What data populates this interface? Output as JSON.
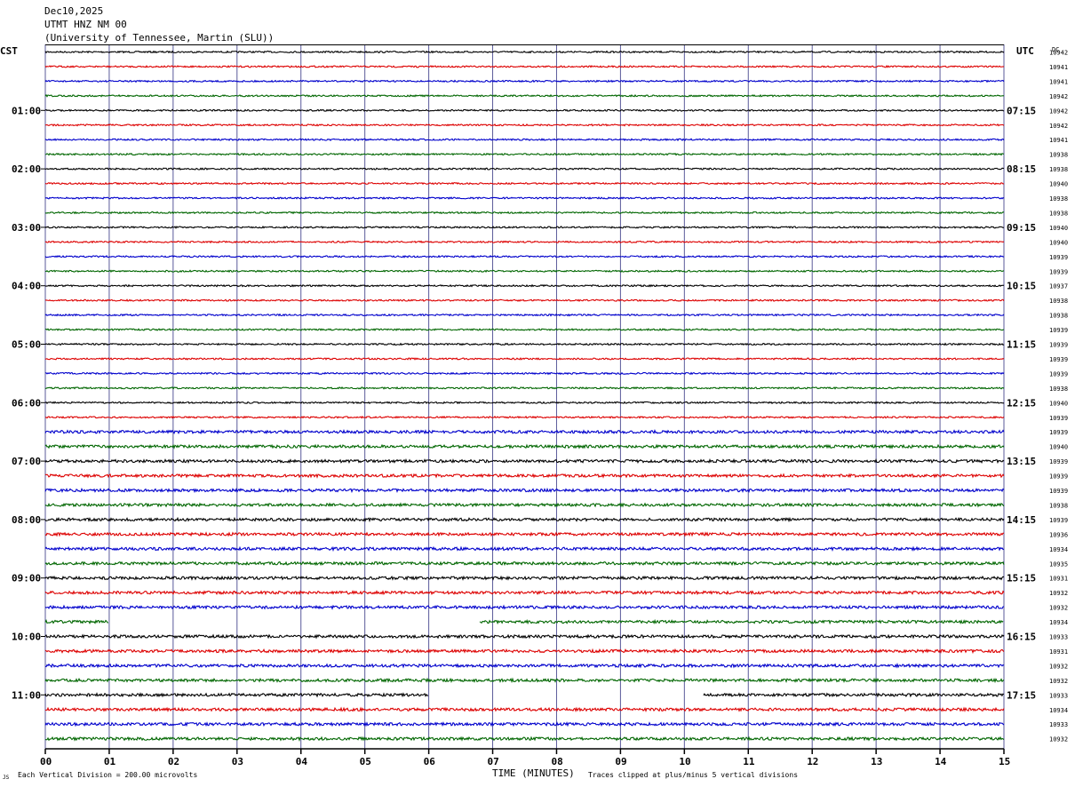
{
  "header": {
    "date": "Dec10,2025",
    "station": "UTMT HNZ NM 00",
    "network": "(University of Tennessee, Martin (SLU))"
  },
  "left_zone": "CST",
  "right_zone": "UTC",
  "dc_header": "DC",
  "footer": {
    "scale": "Each Vertical Division =  200.00 microvolts",
    "xlabel": "TIME (MINUTES)",
    "clip_note": "Traces clipped at plus/minus 5 vertical divisions",
    "corner_mark": "JS"
  },
  "colors": {
    "trace_cycle": [
      "#000000",
      "#dd0000",
      "#0000cc",
      "#006600"
    ],
    "grid_line": "#5a5a9a",
    "text": "#000000"
  },
  "chart_data": {
    "type": "helicorder",
    "title": "UTMT HNZ NM 00",
    "xlabel": "TIME (MINUTES)",
    "xlim": [
      0,
      15
    ],
    "x_ticks": [
      "00",
      "01",
      "02",
      "03",
      "04",
      "05",
      "06",
      "07",
      "08",
      "09",
      "10",
      "11",
      "12",
      "13",
      "14",
      "15"
    ],
    "rows": 48,
    "minutes_per_row": 15,
    "left_hour_labels": [
      "01:00",
      "02:00",
      "03:00",
      "04:00",
      "05:00",
      "06:00",
      "07:00",
      "08:00",
      "09:00",
      "10:00",
      "11:00"
    ],
    "right_hour_labels": [
      "07:15",
      "08:15",
      "09:15",
      "10:15",
      "11:15",
      "12:15",
      "13:15",
      "14:15",
      "15:15",
      "16:15",
      "17:15"
    ],
    "dc_offsets": [
      10942,
      10941,
      10941,
      10942,
      10942,
      10942,
      10941,
      10938,
      10938,
      10940,
      10938,
      10938,
      10940,
      10940,
      10939,
      10939,
      10937,
      10938,
      10938,
      10939,
      10939,
      10939,
      10939,
      10938,
      10940,
      10939,
      10939,
      10940,
      10939,
      10939,
      10939,
      10938,
      10939,
      10936,
      10934,
      10935,
      10931,
      10932,
      10932,
      10934,
      10933,
      10931,
      10932,
      10932,
      10933,
      10934,
      10933,
      10932
    ],
    "gaps": [
      {
        "row": 39,
        "start_min": 1.0,
        "end_min": 6.8
      },
      {
        "row": 44,
        "start_min": 6.0,
        "end_min": 10.3
      }
    ],
    "scale_microvolts_per_division": 200.0,
    "clip_divisions": 5
  }
}
